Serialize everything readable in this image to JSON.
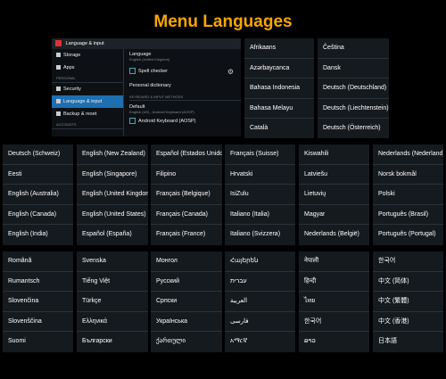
{
  "title": "Menu Languages",
  "settings": {
    "header": "Language & input",
    "items": [
      "Storage",
      "Apps"
    ],
    "personal_head": "PERSONAL",
    "items2": [
      "Security",
      "Language & input",
      "Backup & reset"
    ],
    "accounts_head": "ACCOUNTS",
    "language_title": "Language",
    "language_sub": "English (United Kingdom)",
    "spell_checker": "Spell checker",
    "personal_dictionary": "Personal dictionary",
    "keyboard_head": "KEYBOARD & INPUT METHODS",
    "default_title": "Default",
    "default_sub": "English (UK) - Android Keyboard (AOSP)",
    "android_keyboard": "Android Keyboard (AOSP)"
  },
  "top_columns": [
    [
      "Afrikaans",
      "Azərbaycanca",
      "Bahasa Indonesia",
      "Bahasa Melayu",
      "Català"
    ],
    [
      "Čeština",
      "Dansk",
      "Deutsch (Deutschland)",
      "Deutsch (Liechtenstein)",
      "Deutsch (Österreich)"
    ]
  ],
  "mid_columns": [
    [
      "Deutsch (Schweiz)",
      "Eesti",
      "English (Australia)",
      "English (Canada)",
      "English (India)"
    ],
    [
      "English (New Zealand)",
      "English (Singapore)",
      "English (United Kingdom)",
      "English (United States)",
      "Español (España)"
    ],
    [
      "Español (Estados Unidos)",
      "Filipino",
      "Français (Belgique)",
      "Français (Canada)",
      "Français (France)"
    ],
    [
      "Français (Suisse)",
      "Hrvatski",
      "IsiZulu",
      "Italiano (Italia)",
      "Italiano (Svizzera)"
    ],
    [
      "Kiswahili",
      "Latviešu",
      "Lietuvių",
      "Magyar",
      "Nederlands (België)"
    ],
    [
      "Nederlands (Nederland)",
      "Norsk bokmål",
      "Polski",
      "Português (Brasil)",
      "Português (Portugal)"
    ]
  ],
  "bot_columns": [
    [
      "Română",
      "Rumantsch",
      "Slovenčina",
      "Slovenščina",
      "Suomi"
    ],
    [
      "Svenska",
      "Tiếng Việt",
      "Türkçe",
      "Ελληνικά",
      "Български"
    ],
    [
      "Монгол",
      "Русский",
      "Српски",
      "Українська",
      "ქართული"
    ],
    [
      "Հայերեն",
      "עברית",
      "العربية",
      "فارسی",
      "አማርኛ"
    ],
    [
      "नेपाली",
      "हिन्दी",
      "ไทย",
      "한국어",
      "ລາວ"
    ],
    [
      "한국어",
      "中文 (简体)",
      "中文 (繁體)",
      "中文 (香港)",
      "日本語"
    ]
  ]
}
